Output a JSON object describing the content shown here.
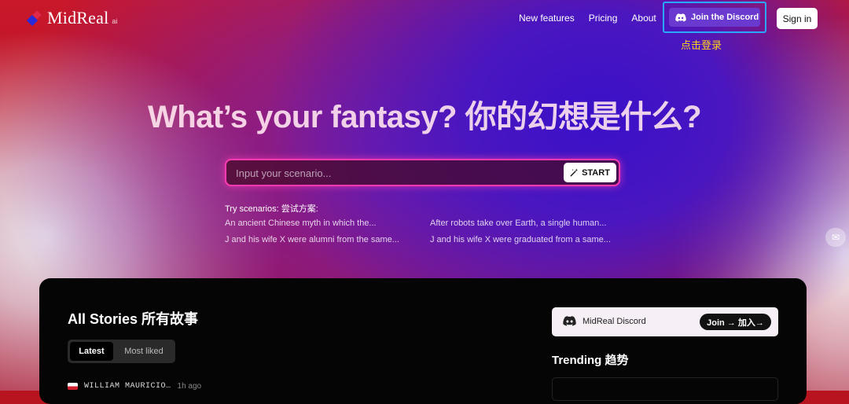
{
  "brand": {
    "name": "MidReal",
    "sup": "ai"
  },
  "nav": {
    "items": [
      {
        "label": "New features"
      },
      {
        "label": "Pricing"
      },
      {
        "label": "About"
      }
    ],
    "discord_label": "Join the Discord",
    "discord_note": "点击登录",
    "signin_label": "Sign in"
  },
  "hero": {
    "title": "What’s your fantasy? 你的幻想是什么?"
  },
  "search": {
    "placeholder": "Input your scenario...",
    "start_label": "START"
  },
  "scenarios": {
    "label": "Try scenarios: 尝试方案:",
    "items": [
      "An ancient Chinese myth in which the...",
      "After robots take over Earth, a single human...",
      "J and his wife X were alumni from the same...",
      "J and his wife X were graduated from a same..."
    ]
  },
  "stories": {
    "title": "All Stories 所有故事",
    "tabs": [
      {
        "label": "Latest"
      },
      {
        "label": "Most liked"
      }
    ],
    "first_author": "WILLIAM MAURICIO…",
    "first_time": "1h ago"
  },
  "discord_card": {
    "label": "MidReal Discord",
    "join_label": "Join → 加入→"
  },
  "trending": {
    "title": "Trending 趋势"
  },
  "colors": {
    "accent_pink": "#ff3ab0",
    "discord_purple": "#6a3ad0",
    "highlight_blue": "#2aa8ff",
    "note_yellow": "#ffd21a"
  }
}
